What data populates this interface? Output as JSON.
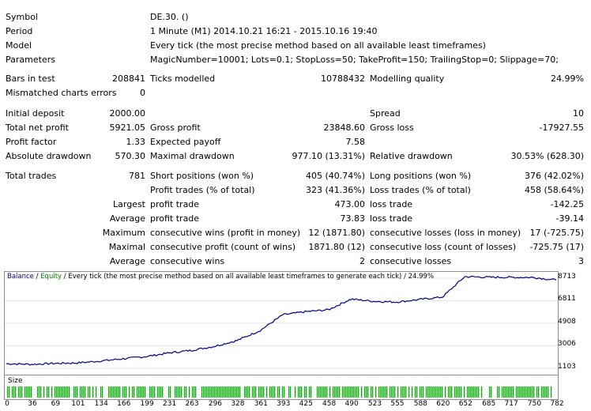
{
  "info": {
    "symbol_label": "Symbol",
    "symbol": "DE.30. ()",
    "period_label": "Period",
    "period": "1 Minute (M1) 2014.10.21 16:21 - 2015.10.16 19:40",
    "model_label": "Model",
    "model": "Every tick (the most precise method based on all available least timeframes)",
    "params_label": "Parameters",
    "params": "MagicNumber=10001; Lots=0.1; StopLoss=50; TakeProfit=150; TrailingStop=0; Slippage=70;"
  },
  "bars": {
    "bars_label": "Bars in test",
    "bars": "208841",
    "ticks_label": "Ticks modelled",
    "ticks": "10788432",
    "quality_label": "Modelling quality",
    "quality": "24.99%",
    "mismatch_label": "Mismatched charts errors",
    "mismatch": "0"
  },
  "money": {
    "deposit_label": "Initial deposit",
    "deposit": "2000.00",
    "spread_label": "Spread",
    "spread": "10",
    "netprofit_label": "Total net profit",
    "netprofit": "5921.05",
    "grossprofit_label": "Gross profit",
    "grossprofit": "23848.60",
    "grossloss_label": "Gross loss",
    "grossloss": "-17927.55",
    "pf_label": "Profit factor",
    "pf": "1.33",
    "ep_label": "Expected payoff",
    "ep": "7.58",
    "absdd_label": "Absolute drawdown",
    "absdd": "570.30",
    "maxdd_label": "Maximal drawdown",
    "maxdd": "977.10 (13.31%)",
    "reldd_label": "Relative drawdown",
    "reldd": "30.53% (628.30)"
  },
  "trades": {
    "total_label": "Total trades",
    "total": "781",
    "short_label": "Short positions (won %)",
    "short": "405 (40.74%)",
    "long_label": "Long positions (won %)",
    "long": "376 (42.02%)",
    "ptrades_label": "Profit trades (% of total)",
    "ptrades": "323 (41.36%)",
    "ltrades_label": "Loss trades (% of total)",
    "ltrades": "458 (58.64%)",
    "largest_label": "Largest",
    "largest_pt_label": "profit trade",
    "largest_pt": "473.00",
    "largest_lt_label": "loss trade",
    "largest_lt": "-142.25",
    "average_label": "Average",
    "average_pt_label": "profit trade",
    "average_pt": "73.83",
    "average_lt_label": "loss trade",
    "average_lt": "-39.14",
    "maximum_label": "Maximum",
    "max_cw_label": "consecutive wins (profit in money)",
    "max_cw": "12 (1871.80)",
    "max_cl_label": "consecutive losses (loss in money)",
    "max_cl": "17 (-725.75)",
    "maximal_label": "Maximal",
    "mx_cp_label": "consecutive profit (count of wins)",
    "mx_cp": "1871.80 (12)",
    "mx_cl_label": "consecutive loss (count of losses)",
    "mx_cl": "-725.75 (17)",
    "avg_label": "Average",
    "avg_cw_label": "consecutive wins",
    "avg_cw": "2",
    "avg_cl_label": "consecutive losses",
    "avg_cl": "3"
  },
  "chart_legend": {
    "balance": "Balance",
    "sep1": " / ",
    "equity": "Equity",
    "rest": " / Every tick (the most precise method based on all available least timeframes to generate each tick) / 24.99%",
    "size_label": "Size"
  },
  "colors": {
    "balance": "#00008b",
    "equity": "#008000",
    "size_bar": "#00b400"
  },
  "chart_data": {
    "type": "line",
    "series": [
      {
        "x": [
          0,
          36,
          69,
          101,
          134,
          166,
          199,
          231,
          263,
          296,
          328,
          361,
          393,
          425,
          458,
          490,
          523,
          555,
          588,
          620,
          652,
          685,
          717,
          750,
          782
        ],
        "values": [
          1500,
          1440,
          1520,
          1560,
          1720,
          1910,
          2100,
          2400,
          2620,
          2960,
          3450,
          4300,
          5620,
          5880,
          6050,
          6950,
          6760,
          6700,
          6920,
          7120,
          8850,
          8800,
          8790,
          8780,
          8550
        ]
      }
    ],
    "yticks": [
      "8713",
      "6811",
      "4908",
      "3006",
      "1103"
    ],
    "xticks": [
      "0",
      "36",
      "69",
      "101",
      "134",
      "166",
      "199",
      "231",
      "263",
      "296",
      "328",
      "361",
      "393",
      "425",
      "458",
      "490",
      "523",
      "555",
      "588",
      "620",
      "652",
      "685",
      "717",
      "750",
      "782"
    ],
    "ylim": [
      1103,
      8713
    ],
    "xlim": [
      0,
      782
    ]
  }
}
